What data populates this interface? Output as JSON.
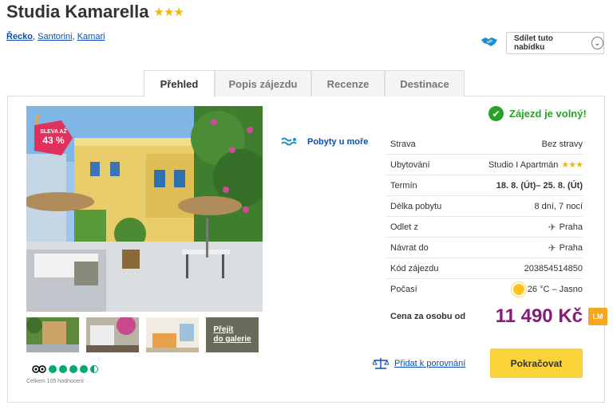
{
  "header": {
    "title": "Studia Kamarella",
    "stars": "★★★",
    "breadcrumb": [
      "Řecko",
      "Santorini",
      "Kamari"
    ],
    "share_label": "Sdílet tuto nabídku"
  },
  "tabs": [
    "Přehled",
    "Popis zájezdu",
    "Recenze",
    "Destinace"
  ],
  "badge": {
    "line1": "SLEVA AŽ",
    "line2": "43 %"
  },
  "gallery_label": {
    "line1": "Přejít",
    "line2": "do galerie"
  },
  "tripadvisor": {
    "rating": 4.5,
    "reviews": "Celkem 105 hodnocení"
  },
  "beach_label": "Pobyty u moře",
  "availability": "Zájezd je volný!",
  "details": [
    {
      "label": "Strava",
      "value": "Bez stravy"
    },
    {
      "label": "Ubytování",
      "value": "Studio I Apartmán",
      "stars": "★★★"
    },
    {
      "label": "Termín",
      "value": "18. 8. (Út)– 25. 8. (Út)"
    },
    {
      "label": "Délka pobytu",
      "value": "8 dní, 7 nocí"
    },
    {
      "label": "Odlet z",
      "value": "Praha",
      "icon": "plane-icon"
    },
    {
      "label": "Návrat do",
      "value": "Praha",
      "icon": "plane-icon"
    },
    {
      "label": "Kód zájezdu",
      "value": "203854514850"
    },
    {
      "label": "Počasí",
      "value": "26 °C – Jasno",
      "icon": "sun-icon"
    }
  ],
  "price": {
    "label": "Cena za osobu od",
    "value": "11 490 Kč",
    "tag": "LM"
  },
  "compare_label": "Přidat k porovnání",
  "continue_label": "Pokračovat",
  "colors": {
    "accent": "#0a4db3",
    "price": "#8a1a7a",
    "cta": "#fdd33a",
    "ok": "#2aa02a"
  }
}
